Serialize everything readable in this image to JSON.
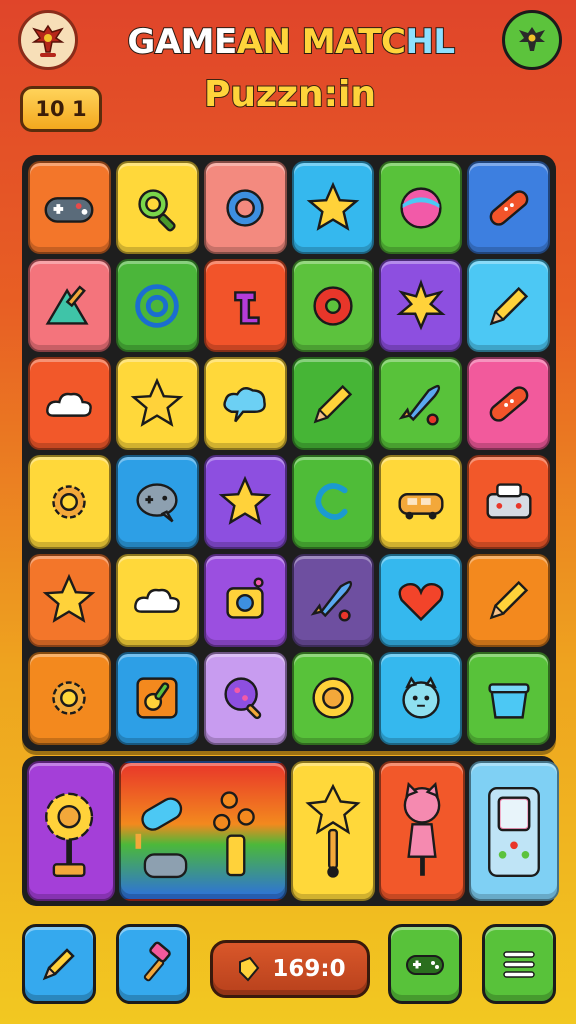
{
  "header": {
    "title_part1": "GAME",
    "title_part2": "AN MATC",
    "title_part3": "HL",
    "subtitle": "Puzzn:in",
    "level_badge": "10 1"
  },
  "board": {
    "rows": [
      [
        {
          "icon": "gamepad-icon",
          "color": "#f3762a"
        },
        {
          "icon": "magnifier-icon",
          "color": "#ffd83a"
        },
        {
          "icon": "ring-icon",
          "color": "#f38a7f"
        },
        {
          "icon": "star-icon",
          "color": "#35b8ee"
        },
        {
          "icon": "ball-icon",
          "color": "#58c23a"
        },
        {
          "icon": "bandage-icon",
          "color": "#3d7fe0"
        }
      ],
      [
        {
          "icon": "mountain-icon",
          "color": "#f4747c"
        },
        {
          "icon": "at-swirl-icon",
          "color": "#4bb63a"
        },
        {
          "icon": "letter-t-icon",
          "color": "#f2542a"
        },
        {
          "icon": "donut-icon",
          "color": "#5cc23d"
        },
        {
          "icon": "burst-star-icon",
          "color": "#8d4fe0"
        },
        {
          "icon": "pencil-icon",
          "color": "#4cc8f4"
        }
      ],
      [
        {
          "icon": "cloud-icon",
          "color": "#f2582a"
        },
        {
          "icon": "star-icon",
          "color": "#ffd83a"
        },
        {
          "icon": "speech-cloud-icon",
          "color": "#ffd83a"
        },
        {
          "icon": "pencil-icon",
          "color": "#46b536"
        },
        {
          "icon": "rocket-icon",
          "color": "#58c23a"
        },
        {
          "icon": "bandage-icon",
          "color": "#f25a9c"
        }
      ],
      [
        {
          "icon": "gear-icon",
          "color": "#ffd83a"
        },
        {
          "icon": "gamepad-bubble-icon",
          "color": "#2d9fe6"
        },
        {
          "icon": "star-icon",
          "color": "#8d4fe0"
        },
        {
          "icon": "swirl-c-icon",
          "color": "#4fbc38"
        },
        {
          "icon": "car-icon",
          "color": "#ffd83a"
        },
        {
          "icon": "console-icon",
          "color": "#f2582a"
        }
      ],
      [
        {
          "icon": "star-icon",
          "color": "#f3762a"
        },
        {
          "icon": "cloud-icon",
          "color": "#ffd83a"
        },
        {
          "icon": "camera-icon",
          "color": "#9b4fe0"
        },
        {
          "icon": "rocket-icon",
          "color": "#6e4fa0"
        },
        {
          "icon": "heart-icon",
          "color": "#35b8ee"
        },
        {
          "icon": "pencil-icon",
          "color": "#f3891e"
        }
      ],
      [
        {
          "icon": "gear-icon",
          "color": "#f3891e"
        },
        {
          "icon": "spoon-icon",
          "color": "#2d9fe6"
        },
        {
          "icon": "lollipop-icon",
          "color": "#c89cf0"
        },
        {
          "icon": "target-icon",
          "color": "#58c23a"
        },
        {
          "icon": "face-icon",
          "color": "#35b8ee"
        },
        {
          "icon": "basket-icon",
          "color": "#58c23a"
        }
      ]
    ]
  },
  "tray": [
    {
      "icon": "sunflower-icon",
      "color": "#a43fd8"
    },
    {
      "icon": "popsicle-bouquet-icon",
      "color": "#4cb83a"
    },
    {
      "icon": "star-wand-icon",
      "color": "#ffd83a"
    },
    {
      "icon": "cat-pin-icon",
      "color": "#f2582a"
    },
    {
      "icon": "handheld-console-icon",
      "color": "#7fd0f4"
    }
  ],
  "bottom_bar": {
    "pencil_button": "pencil-icon",
    "hammer_button": "hammer-icon",
    "score": "169:0",
    "gamepad_button": "gamepad-icon",
    "menu_button": "menu-icon"
  }
}
